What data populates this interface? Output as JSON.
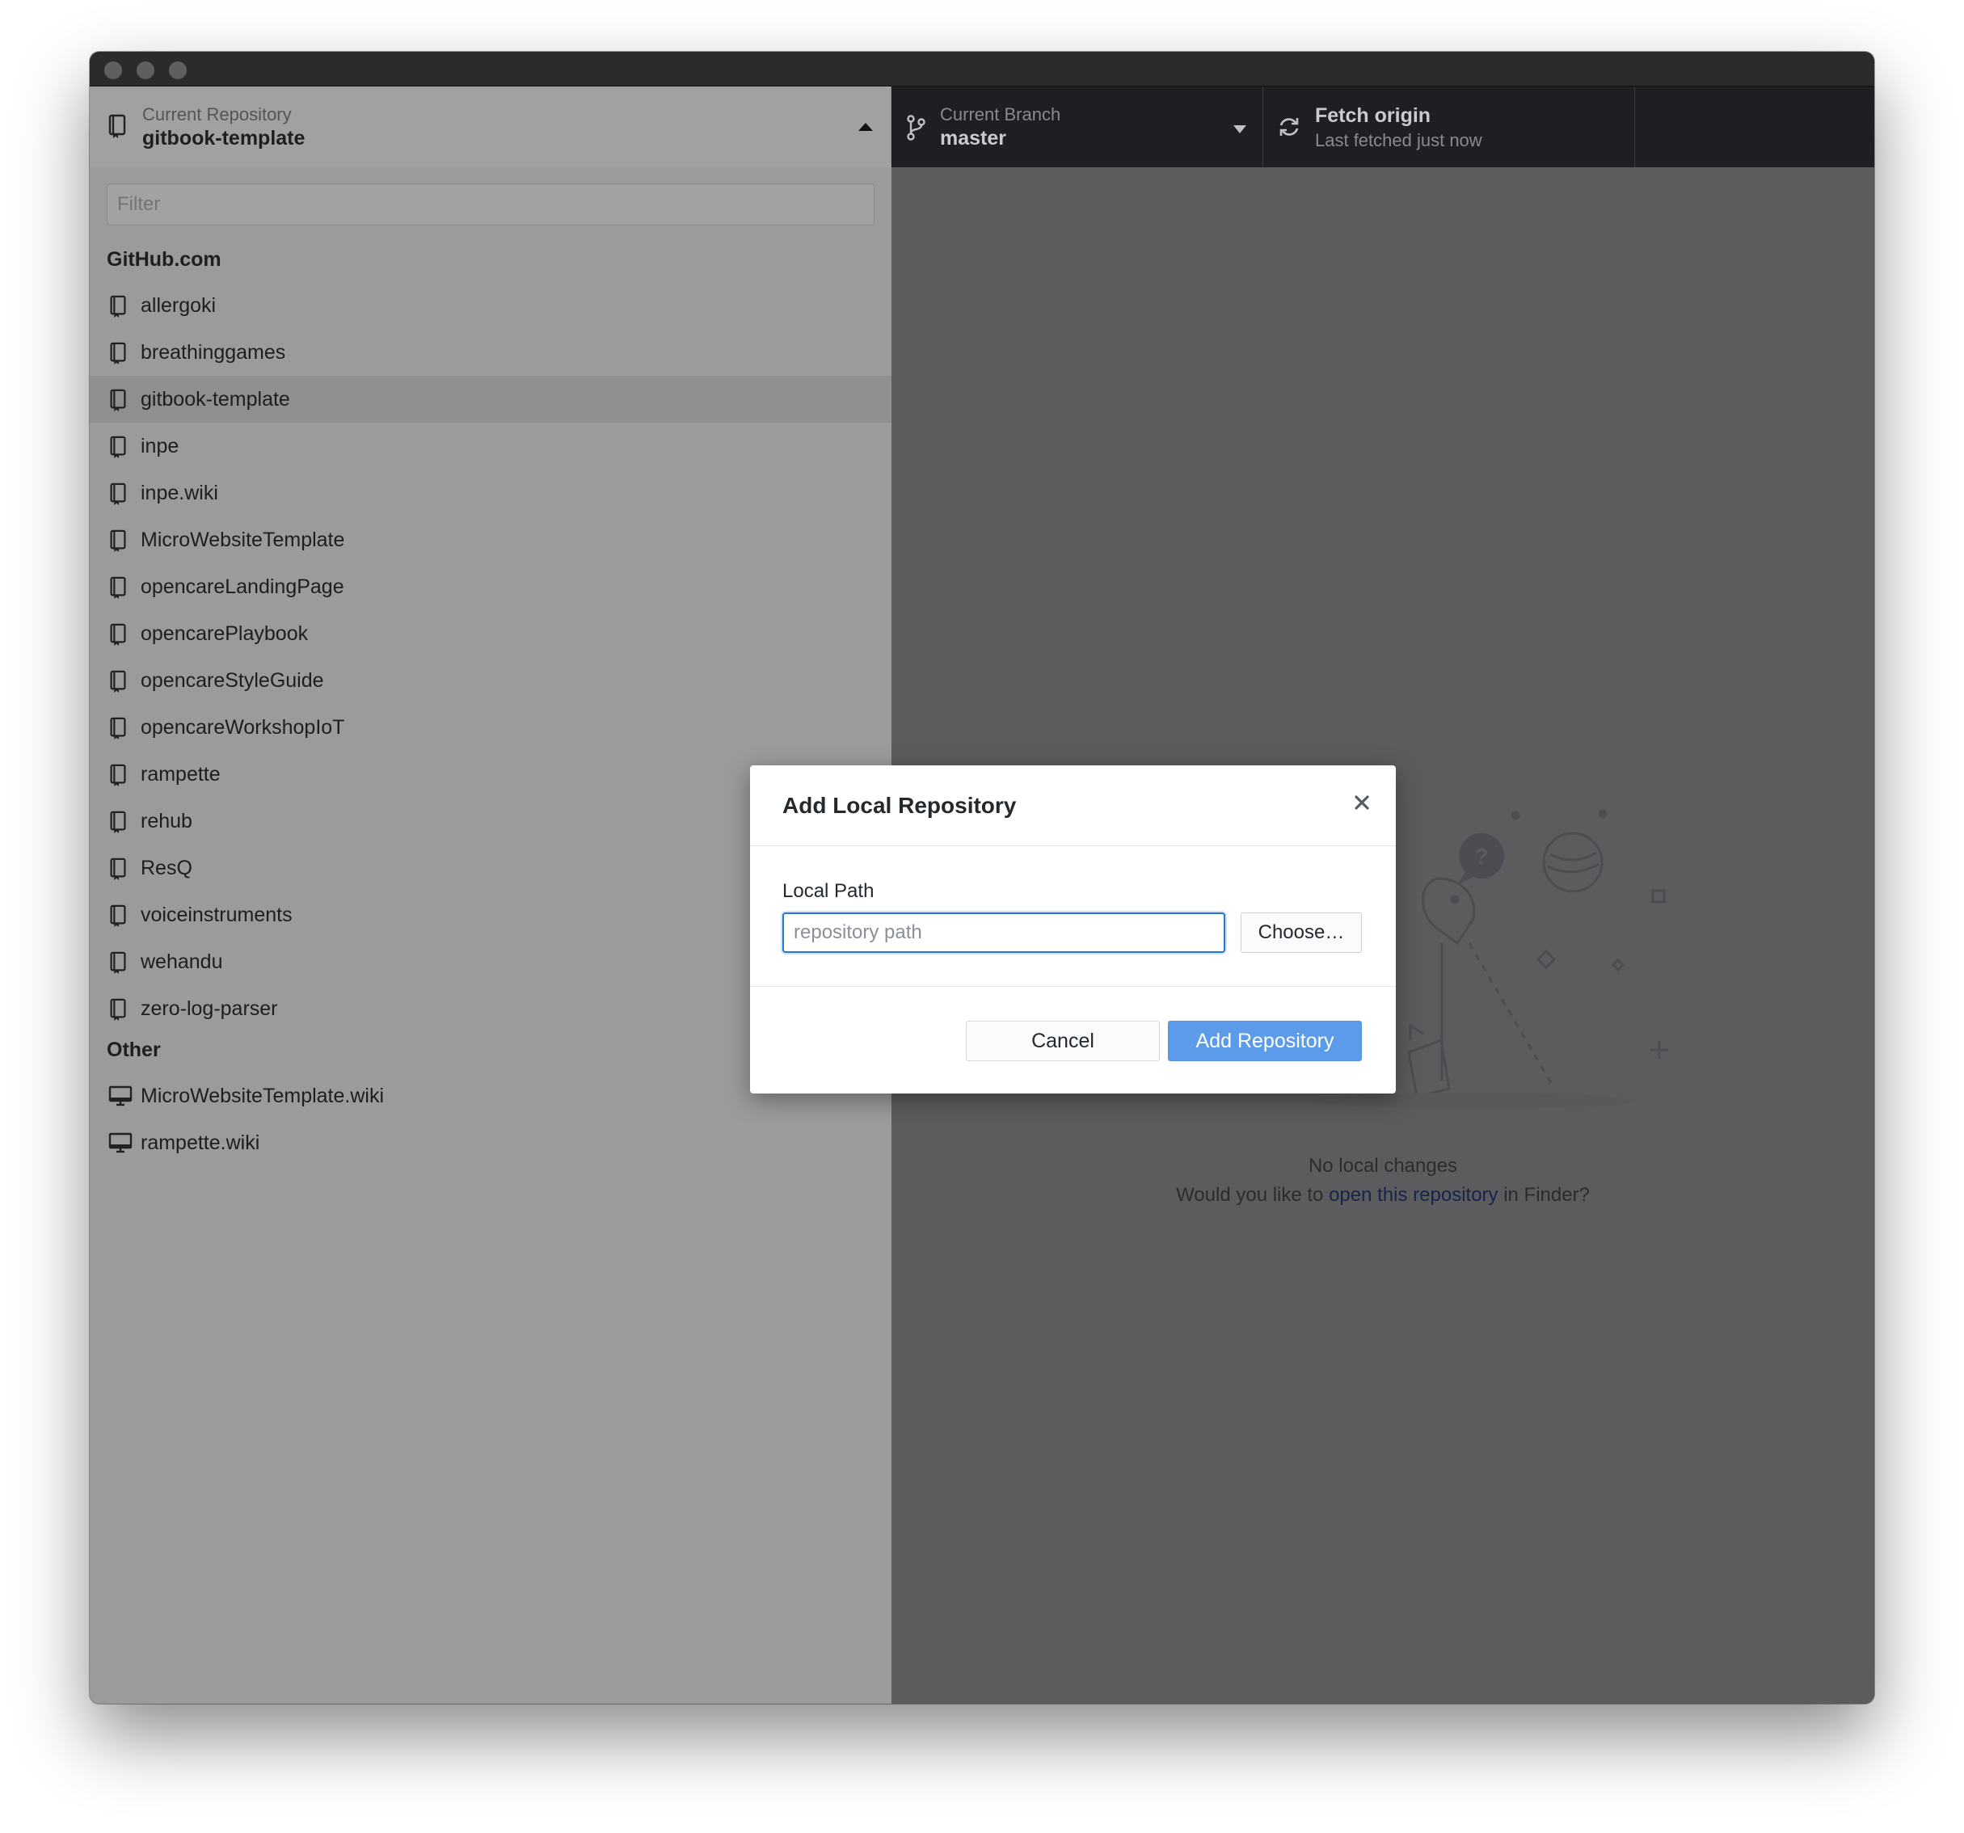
{
  "toolbar": {
    "repository": {
      "label": "Current Repository",
      "value": "gitbook-template"
    },
    "branch": {
      "label": "Current Branch",
      "value": "master"
    },
    "fetch": {
      "title": "Fetch origin",
      "subtitle": "Last fetched just now"
    }
  },
  "sidebar": {
    "filter_placeholder": "Filter",
    "groups": [
      {
        "title": "GitHub.com",
        "items": [
          "allergoki",
          "breathinggames",
          "gitbook-template",
          "inpe",
          "inpe.wiki",
          "MicroWebsiteTemplate",
          "opencareLandingPage",
          "opencarePlaybook",
          "opencareStyleGuide",
          "opencareWorkshopIoT",
          "rampette",
          "rehub",
          "ResQ",
          "voiceinstruments",
          "wehandu",
          "zero-log-parser"
        ]
      },
      {
        "title": "Other",
        "items": [
          "MicroWebsiteTemplate.wiki",
          "rampette.wiki"
        ]
      }
    ],
    "selected": "gitbook-template"
  },
  "main": {
    "blank_title": "No local changes",
    "blank_prefix": "Would you like to ",
    "blank_link": "open this repository",
    "blank_suffix": " in Finder?"
  },
  "dialog": {
    "title": "Add Local Repository",
    "field_label": "Local Path",
    "input_placeholder": "repository path",
    "input_value": "",
    "choose_label": "Choose…",
    "cancel_label": "Cancel",
    "submit_label": "Add Repository"
  },
  "colors": {
    "primary_button": "#5c9bea",
    "link": "#15264a",
    "toolbar_dark": "#1d1f22"
  }
}
